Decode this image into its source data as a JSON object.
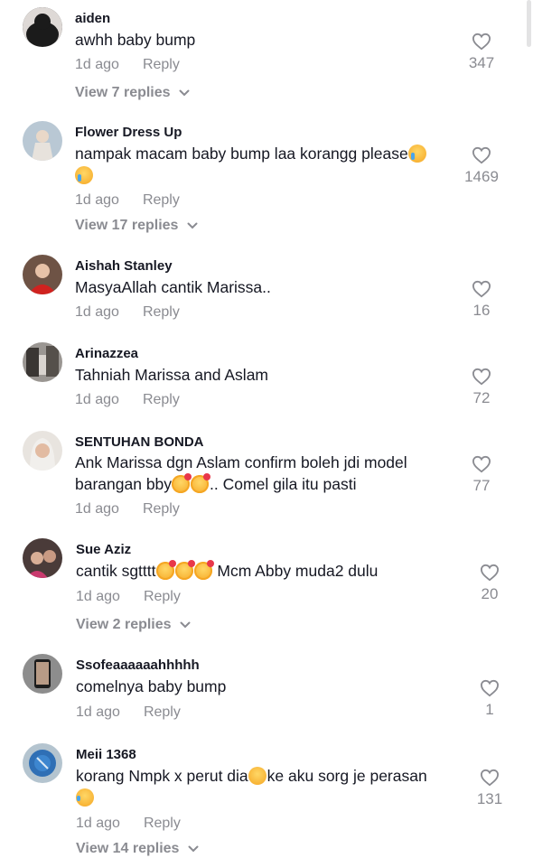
{
  "comments": [
    {
      "username": "aiden",
      "text": "awhh baby bump",
      "time": "1d ago",
      "reply": "Reply",
      "likes": "347",
      "view_replies": "View 7 replies"
    },
    {
      "username": "Flower Dress Up",
      "text_line1": "nampak macam baby bump laa korangg please",
      "time": "1d ago",
      "reply": "Reply",
      "likes": "1469",
      "view_replies": "View 17 replies"
    },
    {
      "username": "Aishah Stanley",
      "text": "MasyaAllah cantik Marissa..",
      "time": "1d ago",
      "reply": "Reply",
      "likes": "16"
    },
    {
      "username": "Arinazzea",
      "text": "Tahniah Marissa and Aslam",
      "time": "1d ago",
      "reply": "Reply",
      "likes": "72"
    },
    {
      "username": "SENTUHAN BONDA",
      "text_line1": "Ank Marissa dgn Aslam confirm boleh jdi model",
      "text_line2a": "barangan bby",
      "text_line2b": ".. Comel gila itu pasti",
      "time": "1d ago",
      "reply": "Reply",
      "likes": "77"
    },
    {
      "username": "Sue Aziz",
      "text_a": "cantik sgtttt",
      "text_b": " Mcm Abby muda2 dulu",
      "time": "1d ago",
      "reply": "Reply",
      "likes": "20",
      "view_replies": "View 2 replies"
    },
    {
      "username": "Ssofeaaaaaahhhhh",
      "text": "comelnya baby bump",
      "time": "1d ago",
      "reply": "Reply",
      "likes": "1"
    },
    {
      "username": "Meii 1368",
      "text_a": "korang Nmpk x perut dia",
      "text_b": "ke aku sorg je perasan",
      "time": "1d ago",
      "reply": "Reply",
      "likes": "131",
      "view_replies": "View 14 replies"
    }
  ],
  "icons": {
    "like": "heart-outline-icon",
    "chevron": "chevron-down-icon"
  },
  "colors": {
    "text": "#161823",
    "muted": "#8a8b91",
    "background": "#ffffff"
  }
}
